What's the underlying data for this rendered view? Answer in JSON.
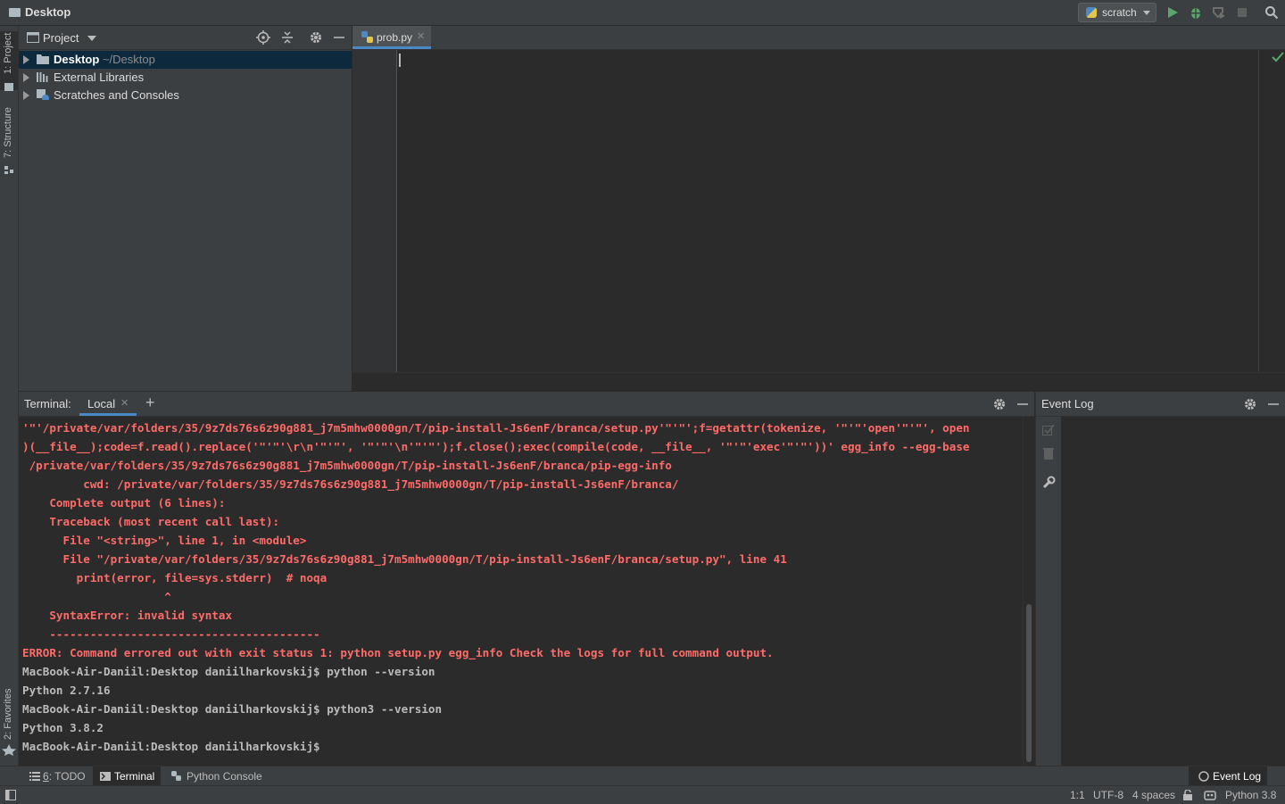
{
  "window": {
    "title": "Desktop"
  },
  "toolbar": {
    "run_config": "scratch"
  },
  "left_strip": {
    "project_tab": "1: Project",
    "structure_tab": "7: Structure",
    "favorites_tab": "2: Favorites"
  },
  "project_panel": {
    "header": "Project",
    "tree": [
      {
        "name": "Desktop",
        "path": "~/Desktop"
      },
      {
        "name": "External Libraries"
      },
      {
        "name": "Scratches and Consoles"
      }
    ]
  },
  "editor": {
    "tab": "prob.py"
  },
  "terminal": {
    "label": "Terminal:",
    "tab": "Local",
    "lines": [
      {
        "text": "'\"'/private/var/folders/35/9z7ds76s6z90g881_j7m5mhw0000gn/T/pip-install-Js6enF/branca/setup.py'\"'\"';f=getattr(tokenize, '\"'\"'open'\"'\"', open",
        "kind": "err"
      },
      {
        "text": ")(__file__);code=f.read().replace('\"'\"'\\r\\n'\"'\"', '\"'\"'\\n'\"'\"');f.close();exec(compile(code, __file__, '\"'\"'exec'\"'\"'))' egg_info --egg-base",
        "kind": "err"
      },
      {
        "text": " /private/var/folders/35/9z7ds76s6z90g881_j7m5mhw0000gn/T/pip-install-Js6enF/branca/pip-egg-info",
        "kind": "err"
      },
      {
        "text": "         cwd: /private/var/folders/35/9z7ds76s6z90g881_j7m5mhw0000gn/T/pip-install-Js6enF/branca/",
        "kind": "err"
      },
      {
        "text": "    Complete output (6 lines):",
        "kind": "err"
      },
      {
        "text": "    Traceback (most recent call last):",
        "kind": "err"
      },
      {
        "text": "      File \"<string>\", line 1, in <module>",
        "kind": "err"
      },
      {
        "text": "      File \"/private/var/folders/35/9z7ds76s6z90g881_j7m5mhw0000gn/T/pip-install-Js6enF/branca/setup.py\", line 41",
        "kind": "err"
      },
      {
        "text": "        print(error, file=sys.stderr)  # noqa",
        "kind": "err"
      },
      {
        "text": "                     ^",
        "kind": "err"
      },
      {
        "text": "    SyntaxError: invalid syntax",
        "kind": "err"
      },
      {
        "text": "    ----------------------------------------",
        "kind": "err"
      },
      {
        "text": "ERROR: Command errored out with exit status 1: python setup.py egg_info Check the logs for full command output.",
        "kind": "err"
      },
      {
        "text": "MacBook-Air-Daniil:Desktop daniilharkovskij$ python --version",
        "kind": "norm"
      },
      {
        "text": "Python 2.7.16",
        "kind": "norm"
      },
      {
        "text": "MacBook-Air-Daniil:Desktop daniilharkovskij$ python3 --version",
        "kind": "norm"
      },
      {
        "text": "Python 3.8.2",
        "kind": "norm"
      },
      {
        "text": "MacBook-Air-Daniil:Desktop daniilharkovskij$",
        "kind": "norm"
      }
    ]
  },
  "event_log": {
    "title": "Event Log"
  },
  "bottom_tabs": {
    "todo_num": "6",
    "todo_rest": ": TODO",
    "terminal": "Terminal",
    "python_console": "Python Console",
    "event_log": "Event Log"
  },
  "status_bar": {
    "position": "1:1",
    "encoding": "UTF-8",
    "indent": "4 spaces",
    "interpreter": "Python 3.8"
  },
  "colors": {
    "error_text": "#ff6b68",
    "accent": "#4a88c7",
    "run_green": "#59a869"
  }
}
